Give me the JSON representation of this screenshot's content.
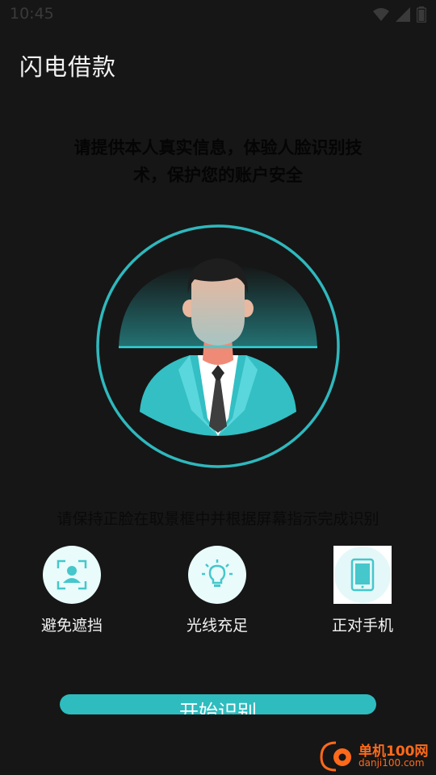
{
  "status_bar": {
    "time": "10:45",
    "icons": [
      "wifi-icon",
      "signal-icon",
      "battery-icon"
    ]
  },
  "app": {
    "title": "闪电借款"
  },
  "instructions": {
    "top_line1": "请提供本人真实信息，体验人脸识别技",
    "top_line2": "术，保护您的账户安全",
    "bottom": "请保持正脸在取景框中并根据屏幕指示完成识别"
  },
  "tips": [
    {
      "label": "避免遮挡",
      "icon": "face-scan-icon"
    },
    {
      "label": "光线充足",
      "icon": "light-bulb-icon"
    },
    {
      "label": "正对手机",
      "icon": "phone-icon"
    }
  ],
  "start_button": {
    "label": "开始识别"
  },
  "watermark": {
    "name": "单机100网",
    "url": "danji100.com"
  },
  "colors": {
    "background": "#161616",
    "accent": "#2ebcbf",
    "icon_bg": "#e9fbfb",
    "watermark": "#ff6a1a"
  }
}
